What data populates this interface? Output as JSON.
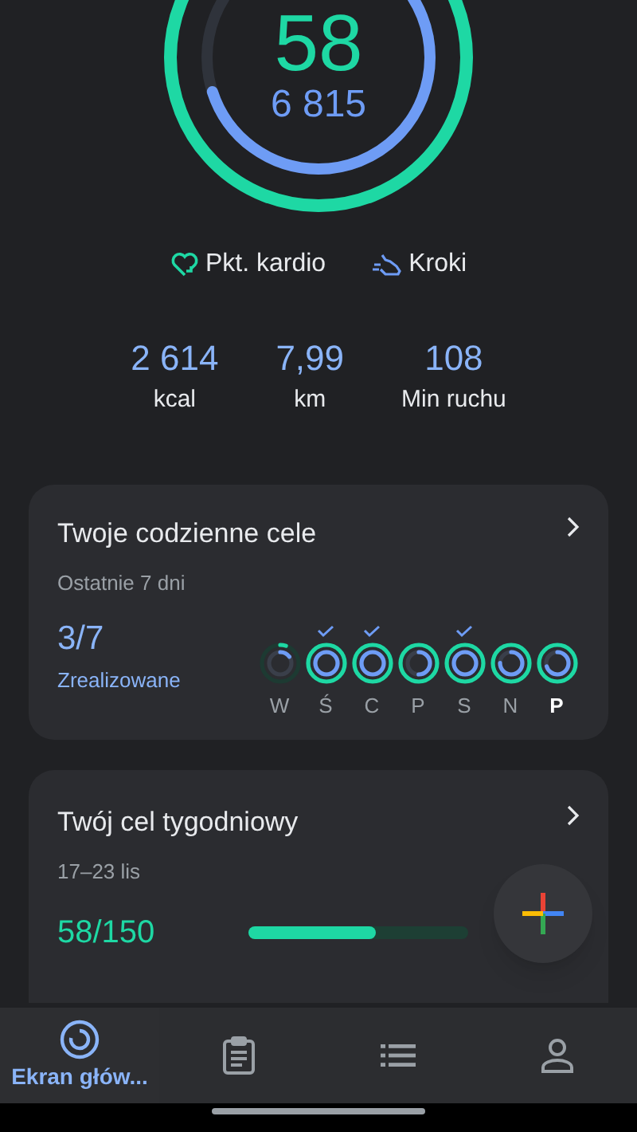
{
  "summary": {
    "cardio_points": "58",
    "steps": "6 815"
  },
  "legend": [
    {
      "kind": "cardio",
      "label": "Pkt. kardio"
    },
    {
      "kind": "steps",
      "label": "Kroki"
    }
  ],
  "stats": [
    {
      "value": "2 614",
      "label": "kcal"
    },
    {
      "value": "7,99",
      "label": "km"
    },
    {
      "value": "108",
      "label": "Min ruchu"
    }
  ],
  "daily_goals": {
    "title": "Twoje codzienne cele",
    "subtitle": "Ostatnie 7 dni",
    "count": "3/7",
    "count_label": "Zrealizowane",
    "days": [
      {
        "label": "W",
        "met": false,
        "today": false
      },
      {
        "label": "Ś",
        "met": true,
        "today": false
      },
      {
        "label": "C",
        "met": true,
        "today": false
      },
      {
        "label": "P",
        "met": false,
        "today": false
      },
      {
        "label": "S",
        "met": true,
        "today": false
      },
      {
        "label": "N",
        "met": false,
        "today": false
      },
      {
        "label": "P",
        "met": false,
        "today": true
      }
    ]
  },
  "weekly_goal": {
    "title": "Twój cel tygodniowy",
    "range": "17–23 lis",
    "value": "58/150",
    "level": 0.58
  },
  "nav": [
    {
      "kind": "home",
      "label": "Ekran głów...",
      "selected": true
    },
    {
      "kind": "journal",
      "selected": false
    },
    {
      "kind": "browse",
      "selected": false
    },
    {
      "kind": "profile",
      "selected": false
    }
  ]
}
